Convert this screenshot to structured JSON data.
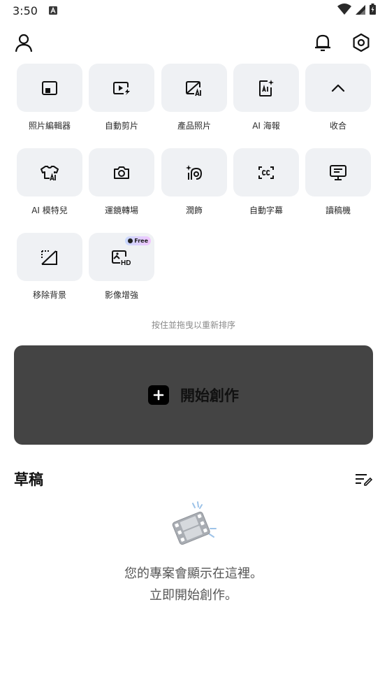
{
  "status": {
    "time": "3:50",
    "notif_icon": "a-badge-icon"
  },
  "tools": [
    {
      "label": "照片編輯器",
      "icon": "photo-editor-icon"
    },
    {
      "label": "自動剪片",
      "icon": "auto-cut-icon"
    },
    {
      "label": "產品照片",
      "icon": "product-photo-icon"
    },
    {
      "label": "AI 海報",
      "icon": "ai-poster-icon"
    },
    {
      "label": "收合",
      "icon": "chevron-up-icon"
    },
    {
      "label": "AI 模特兒",
      "icon": "ai-model-icon"
    },
    {
      "label": "運鏡轉場",
      "icon": "camera-icon"
    },
    {
      "label": "潤飾",
      "icon": "retouch-icon"
    },
    {
      "label": "自動字幕",
      "icon": "captions-icon"
    },
    {
      "label": "讀稿機",
      "icon": "teleprompter-icon"
    },
    {
      "label": "移除背景",
      "icon": "remove-bg-icon"
    },
    {
      "label": "影像增強",
      "icon": "enhance-hd-icon",
      "badge": "Free"
    }
  ],
  "reorder_hint": "按住並拖曳以重新排序",
  "create": {
    "label": "開始創作"
  },
  "drafts": {
    "title": "草稿",
    "empty_line1": "您的專案會顯示在這裡。",
    "empty_line2": "立即開始創作。"
  }
}
